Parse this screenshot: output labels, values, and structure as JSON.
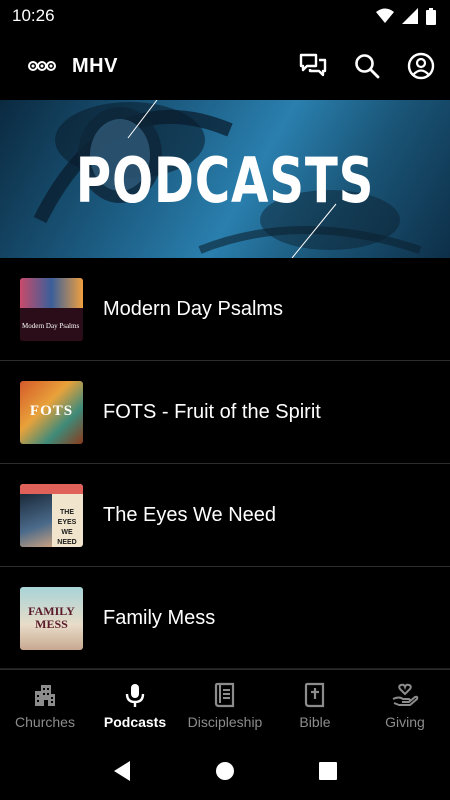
{
  "status_bar": {
    "time": "10:26"
  },
  "app_bar": {
    "title": "MHV"
  },
  "hero": {
    "title": "PODCASTS"
  },
  "podcasts": [
    {
      "title": "Modern Day Psalms",
      "thumb_text": "Modern Day Psalms"
    },
    {
      "title": "FOTS - Fruit of the Spirit",
      "thumb_text": "FOTS"
    },
    {
      "title": "The Eyes We Need",
      "thumb_text": "THE EYES WE NEED"
    },
    {
      "title": "Family Mess",
      "thumb_text": "FAMILY MESS"
    }
  ],
  "bottom_nav": [
    {
      "label": "Churches",
      "icon": "building-icon",
      "active": false
    },
    {
      "label": "Podcasts",
      "icon": "microphone-icon",
      "active": true
    },
    {
      "label": "Discipleship",
      "icon": "book-icon",
      "active": false
    },
    {
      "label": "Bible",
      "icon": "bible-icon",
      "active": false
    },
    {
      "label": "Giving",
      "icon": "heart-hand-icon",
      "active": false
    }
  ],
  "colors": {
    "background": "#000000",
    "active_nav": "#ffffff",
    "inactive_nav": "#8c8c8c",
    "divider": "#2b2b2b"
  }
}
